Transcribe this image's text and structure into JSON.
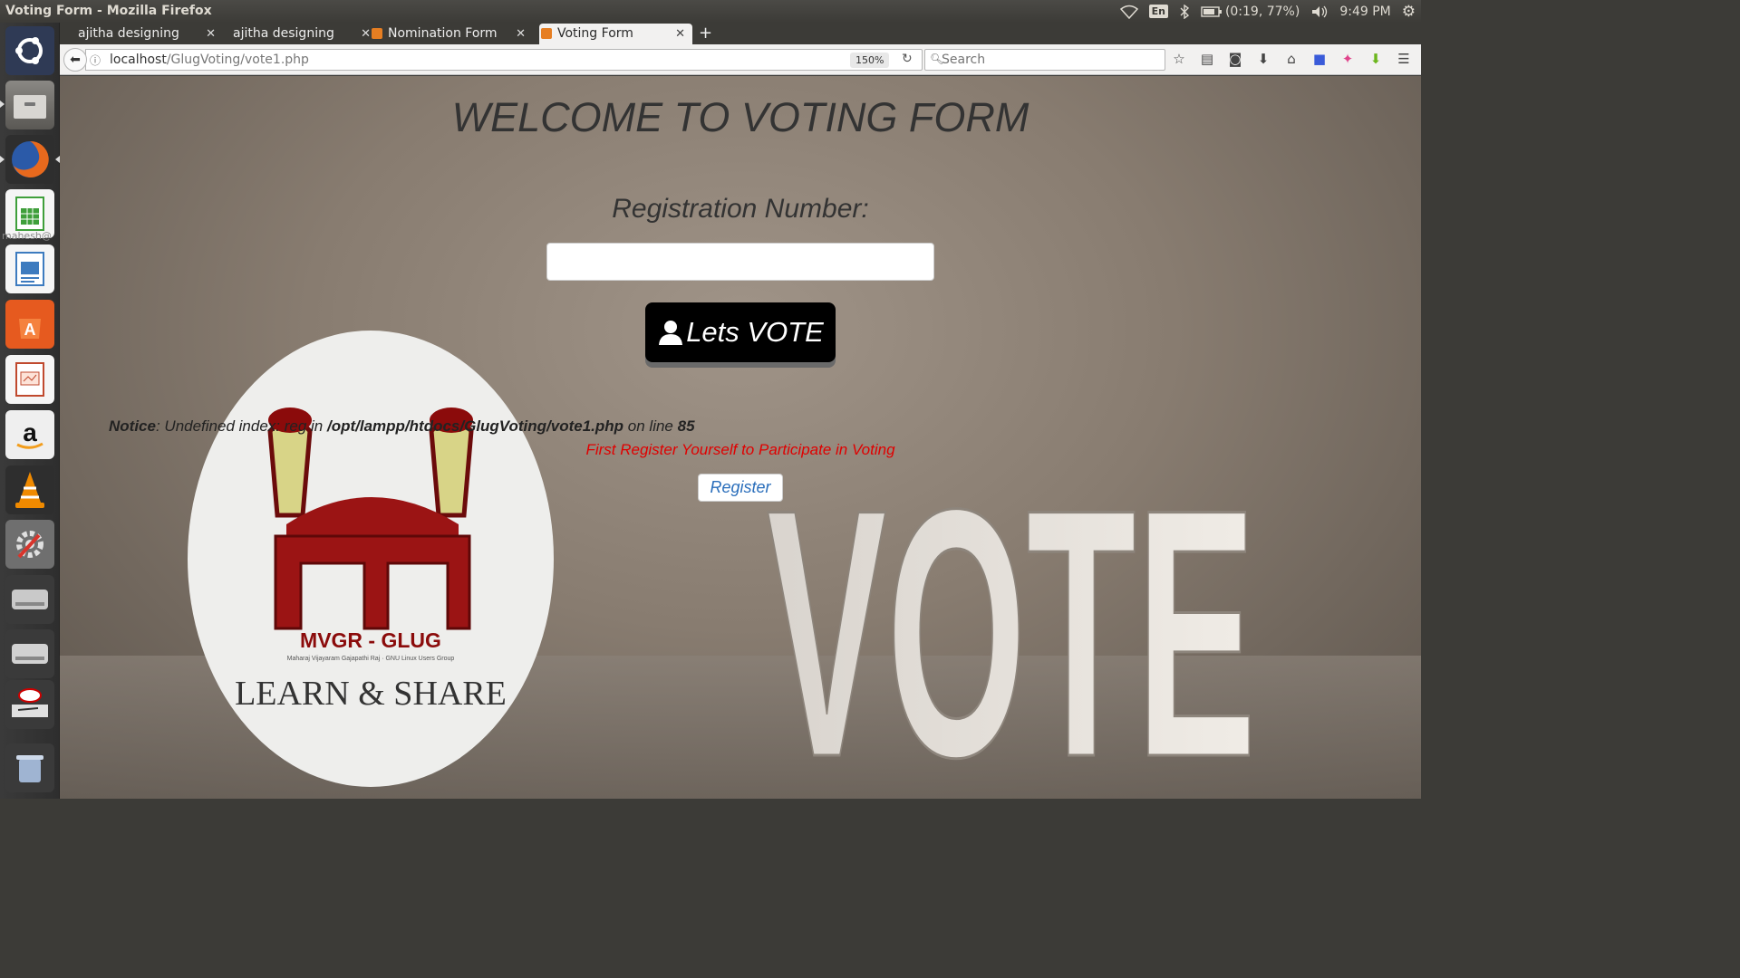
{
  "window": {
    "title": "Voting Form - Mozilla Firefox"
  },
  "system_tray": {
    "language": "En",
    "battery": "(0:19, 77%)",
    "time": "9:49 PM"
  },
  "launcher": {
    "user_text": "mahesh@",
    "apps": [
      {
        "name": "ubuntu-dash-icon",
        "color": "#2f3a55"
      },
      {
        "name": "files-icon",
        "color": "#6c6a66"
      },
      {
        "name": "firefox-icon",
        "color": "#e8691d"
      },
      {
        "name": "spreadsheet-icon",
        "color": "#3f9f3b"
      },
      {
        "name": "writer-icon",
        "color": "#3d7bbf"
      },
      {
        "name": "software-center-icon",
        "color": "#e65a1f"
      },
      {
        "name": "impress-icon",
        "color": "#c0492e"
      },
      {
        "name": "amazon-icon",
        "color": "#efefef"
      },
      {
        "name": "vlc-icon",
        "color": "#f08a00"
      },
      {
        "name": "settings-icon",
        "color": "#7a7a7a"
      },
      {
        "name": "disk-icon",
        "color": "#9a9a9a"
      },
      {
        "name": "disk-icon-2",
        "color": "#a5a5a5"
      },
      {
        "name": "scanner-icon",
        "color": "#cfcfcf"
      },
      {
        "name": "trash-icon",
        "color": "#7c8ea8"
      }
    ]
  },
  "tabs": [
    {
      "label": "ajitha designing",
      "active": false,
      "favicon": false
    },
    {
      "label": "ajitha designing",
      "active": false,
      "favicon": false
    },
    {
      "label": "Nomination Form",
      "active": false,
      "favicon": true
    },
    {
      "label": "Voting Form",
      "active": true,
      "favicon": true
    }
  ],
  "navbar": {
    "url_host": "localhost",
    "url_path": "/GlugVoting/vote1.php",
    "zoom": "150%",
    "search_placeholder": "Search"
  },
  "page": {
    "heading": "WELCOME TO VOTING FORM",
    "registration_label": "Registration Number:",
    "registration_value": "",
    "vote_button": "Lets VOTE",
    "notice_prefix": "Notice",
    "notice_text": ": Undefined index: reg in ",
    "notice_path": "/opt/lampp/htdocs/GlugVoting/vote1.php",
    "notice_online": " on line ",
    "notice_line": "85",
    "error_message": "First Register Yourself to Participate in Voting",
    "register_button": "Register",
    "background_word": "VOTE",
    "logo": {
      "title": "MVGR - GLUG",
      "subtitle": "Maharaj Vijayaram Gajapathi Raj · GNU Linux Users Group",
      "tagline": "LEARN & SHARE"
    }
  }
}
